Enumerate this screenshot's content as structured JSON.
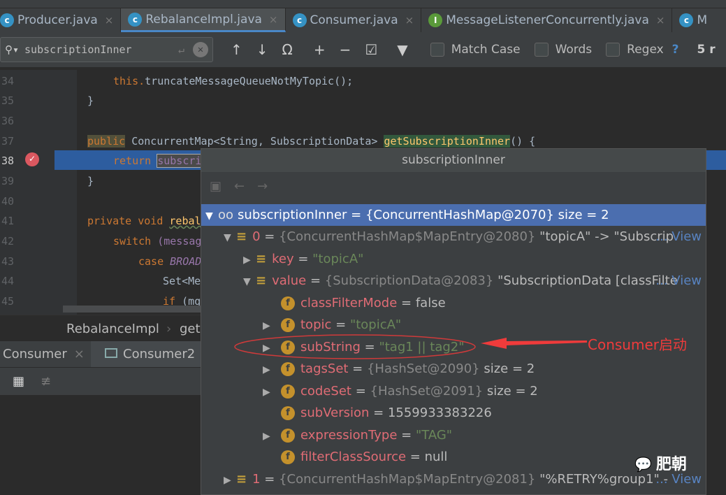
{
  "tabs": [
    {
      "label": "Producer.java",
      "icon": "class-icon",
      "active": false
    },
    {
      "label": "RebalanceImpl.java",
      "icon": "class-icon",
      "active": true
    },
    {
      "label": "Consumer.java",
      "icon": "class-icon",
      "active": false
    },
    {
      "label": "MessageListenerConcurrently.java",
      "icon": "interface-icon",
      "active": false
    },
    {
      "label": "M",
      "icon": "class-icon",
      "active": false
    }
  ],
  "find": {
    "query": "subscriptionInner",
    "match_case": "Match Case",
    "words": "Words",
    "regex": "Regex",
    "help": "?",
    "count": "5 r"
  },
  "editor": {
    "line_numbers": [
      "34",
      "35",
      "36",
      "37",
      "38",
      "39",
      "40",
      "41",
      "42",
      "43",
      "44",
      "45"
    ],
    "lines": {
      "l34_this": "this.",
      "l34_rest": "truncateMessageQueueNotMyTopic();",
      "l35": "}",
      "l37_kw": "public",
      "l37_type": " ConcurrentMap<String, SubscriptionData> ",
      "l37_fn": "getSubscriptionInner",
      "l37_end": "() {",
      "l38_kw": "return ",
      "l38_var": "subscri",
      "l39": "}",
      "l41_kw": "private void ",
      "l41_fn": "rebal",
      "l42_kw": "switch ",
      "l42_rest": "(messag",
      "l43_kw": "case ",
      "l43_rest": "BROAD",
      "l44": "Set<Me",
      "l45_kw": "if ",
      "l45_rest": "(mq"
    }
  },
  "breadcrumb": [
    "RebalanceImpl",
    "get"
  ],
  "bottom_tabs": [
    "Consumer",
    "Consumer2"
  ],
  "popup": {
    "title": "subscriptionInner",
    "rows": [
      {
        "name": "subscriptionInner",
        "eq": " = ",
        "type": "{ConcurrentHashMap@2070}",
        "value": "  size = 2"
      },
      {
        "name": "0",
        "eq": " = ",
        "type": "{ConcurrentHashMap$MapEntry@2080}",
        "value": " \"topicA\" -> \"Subscrip",
        "view": "... View"
      },
      {
        "name": "key",
        "eq": " = ",
        "str": "\"topicA\""
      },
      {
        "name": "value",
        "eq": " = ",
        "type": "{SubscriptionData@2083}",
        "value": " \"SubscriptionData [classFilte",
        "view": "... View"
      },
      {
        "name": "classFilterMode",
        "eq": " = ",
        "value": "false"
      },
      {
        "name": "topic",
        "eq": " = ",
        "str": "\"topicA\""
      },
      {
        "name": "subString",
        "eq": " = ",
        "str": "\"tag1 || tag2\""
      },
      {
        "name": "tagsSet",
        "eq": " = ",
        "type": "{HashSet@2090}",
        "value": "  size = 2"
      },
      {
        "name": "codeSet",
        "eq": " = ",
        "type": "{HashSet@2091}",
        "value": "  size = 2"
      },
      {
        "name": "subVersion",
        "eq": " = ",
        "value": "1559933383226"
      },
      {
        "name": "expressionType",
        "eq": " = ",
        "str": "\"TAG\""
      },
      {
        "name": "filterClassSource",
        "eq": " = ",
        "value": "null"
      },
      {
        "name": "1",
        "eq": " = ",
        "type": "{ConcurrentHashMap$MapEntry@2081}",
        "value": " \"%RETRY%group1\" -",
        "view": "... View"
      }
    ]
  },
  "annotation": "Consumer启动",
  "watermark": "肥朝",
  "colors": {
    "accent": "#4b6eaf",
    "annotation": "#ef3b3b",
    "breakpoint": "#db5860"
  }
}
